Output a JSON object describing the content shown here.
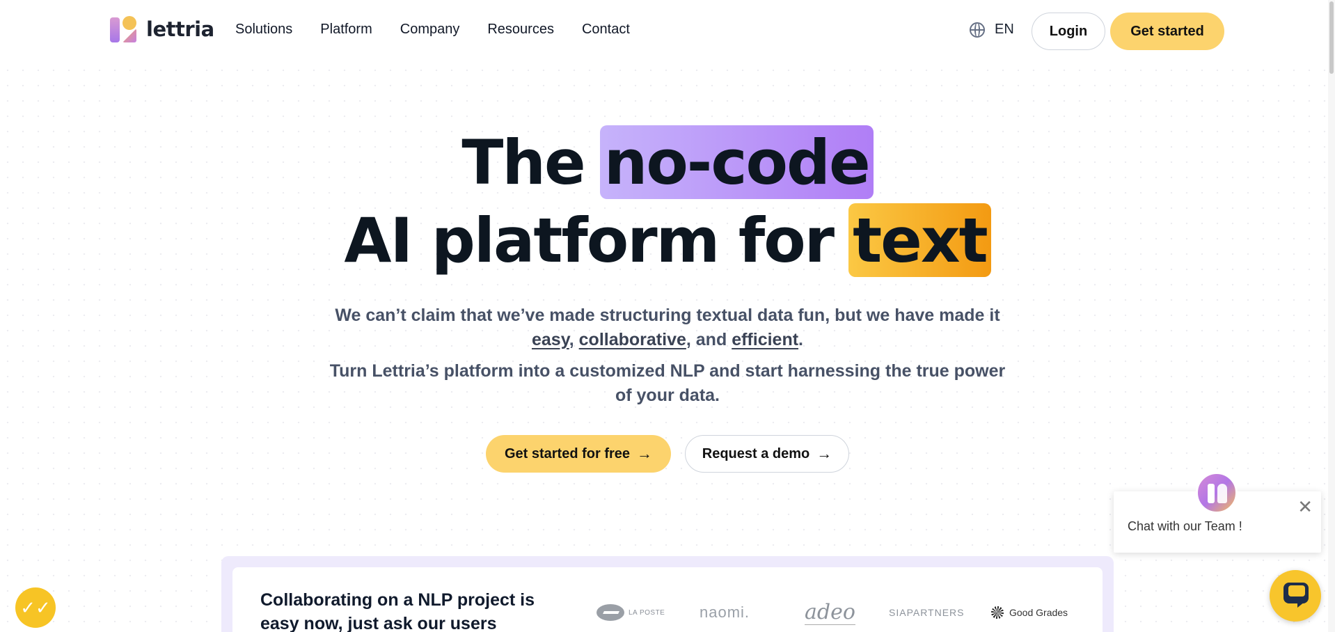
{
  "header": {
    "logo_text": "lettria",
    "nav": [
      "Solutions",
      "Platform",
      "Company",
      "Resources",
      "Contact"
    ],
    "language": "EN",
    "login_label": "Login",
    "get_started_label": "Get started"
  },
  "hero": {
    "line1_prefix": "The",
    "line1_highlight": "no-code",
    "line2_prefix": "AI platform for",
    "line2_highlight": "text",
    "sub1_a": "We can’t claim that we’ve made structuring textual data fun, but we have made it ",
    "sub1_easy": "easy",
    "sub1_sep1": ", ",
    "sub1_collab": "collaborative",
    "sub1_sep2": ", and ",
    "sub1_efficient": "efficient",
    "sub1_end": ".",
    "sub2": "Turn Lettria’s platform into a customized NLP and start harnessing the true power of your data.",
    "cta_free_label": "Get started for free",
    "cta_demo_label": "Request a demo",
    "arrow": "→"
  },
  "logos_band": {
    "text": "Collaborating on a NLP project is easy now, just ask our users",
    "logos": [
      "LA POSTE",
      "naomi.",
      "adeo",
      "SIAPARTNERS",
      "Good Grades"
    ]
  },
  "chat": {
    "message": "Chat with our Team !",
    "close": "✕"
  },
  "cookie": {
    "icon_glyph": "✓✓"
  },
  "colors": {
    "accent_yellow": "#fcd36d",
    "highlight_purple": "#b07ef6",
    "highlight_orange": "#f39a12",
    "text_dark": "#0d1620",
    "text_muted": "#475166"
  }
}
